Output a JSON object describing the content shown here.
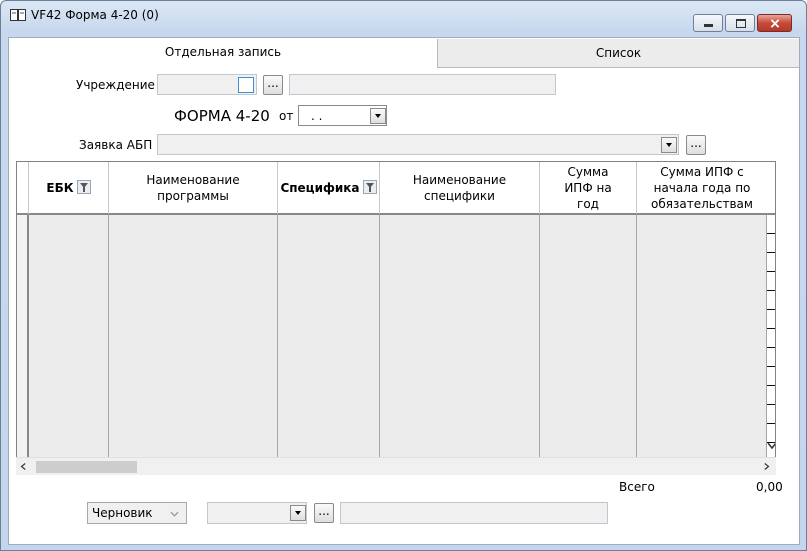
{
  "window": {
    "title": "VF42 Форма 4-20 (0)"
  },
  "tabs": [
    {
      "label": "Отдельная запись",
      "active": true
    },
    {
      "label": "Список",
      "active": false
    }
  ],
  "form": {
    "institution_label": "Учреждение",
    "institution_code": "",
    "institution_name": "",
    "browse_label": "...",
    "form_title": "ФОРМА 4-20",
    "date_label": "от",
    "date_value": ". .",
    "request_label": "Заявка АБП",
    "request_value": ""
  },
  "table": {
    "columns": [
      {
        "label": "ЕБК",
        "bold": true,
        "filter": true
      },
      {
        "label": "Наименование программы",
        "bold": false,
        "filter": false
      },
      {
        "label": "Специфика",
        "bold": true,
        "filter": true
      },
      {
        "label": "Наименование специфики",
        "bold": false,
        "filter": false
      },
      {
        "label": "Сумма ИПФ на год",
        "bold": false,
        "filter": false
      },
      {
        "label": "Сумма ИПФ с начала года по обязательствам",
        "bold": false,
        "filter": false
      }
    ],
    "rows": [
      [],
      [],
      [],
      [],
      [],
      [],
      [],
      [],
      [],
      [],
      [],
      [],
      []
    ]
  },
  "totals": {
    "label": "Всего",
    "value": "0,00"
  },
  "footer": {
    "status_value": "Черновик",
    "combo_value": "",
    "browse_label": "...",
    "text_value": ""
  },
  "icons": {
    "titlebar": "book-icon",
    "filter": "funnel-icon"
  }
}
